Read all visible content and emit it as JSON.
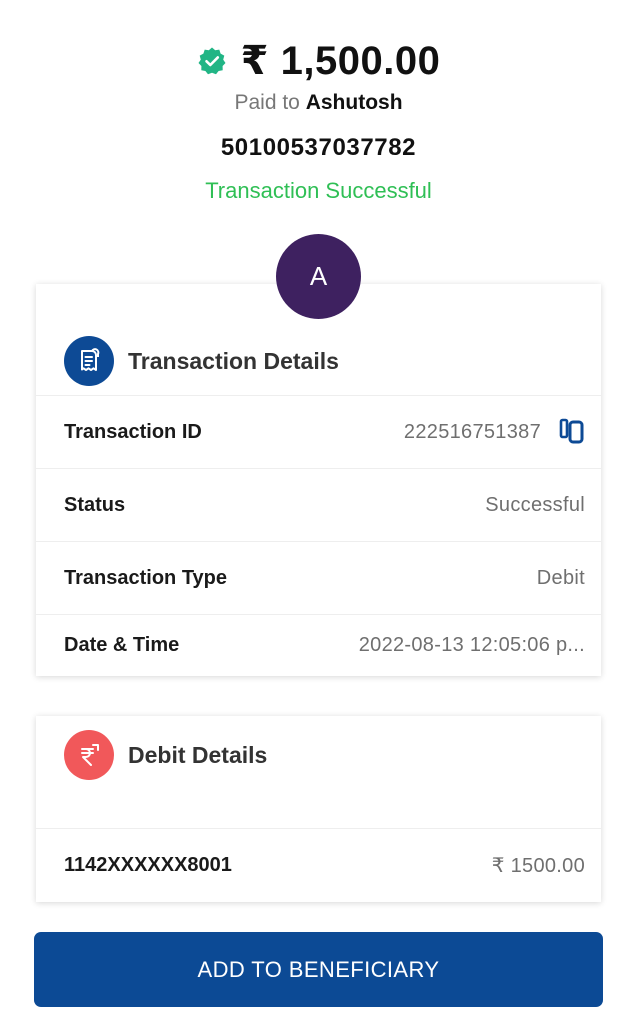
{
  "header": {
    "amount": "₹ 1,500.00",
    "paid_to_prefix": "Paid to",
    "payee_name": "Ashutosh",
    "account_number": "50100537037782",
    "status": "Transaction Successful",
    "status_color": "#2fbf55",
    "verified_icon": "verified-badge-icon"
  },
  "avatar": {
    "initial": "A",
    "color": "#3e2160"
  },
  "transaction_details": {
    "title": "Transaction Details",
    "icon": "receipt-icon",
    "rows": [
      {
        "label": "Transaction ID",
        "value": "222516751387",
        "action_icon": "copy-icon"
      },
      {
        "label": "Status",
        "value": "Successful"
      },
      {
        "label": "Transaction Type",
        "value": "Debit"
      },
      {
        "label": "Date & Time",
        "value": "2022-08-13 12:05:06 p..."
      }
    ]
  },
  "debit_details": {
    "title": "Debit Details",
    "icon": "rupee-icon",
    "rows": [
      {
        "label": "1142XXXXXX8001",
        "value": "₹ 1500.00"
      }
    ]
  },
  "cta": {
    "label": "ADD TO BENEFICIARY",
    "color": "#0c4a95"
  }
}
